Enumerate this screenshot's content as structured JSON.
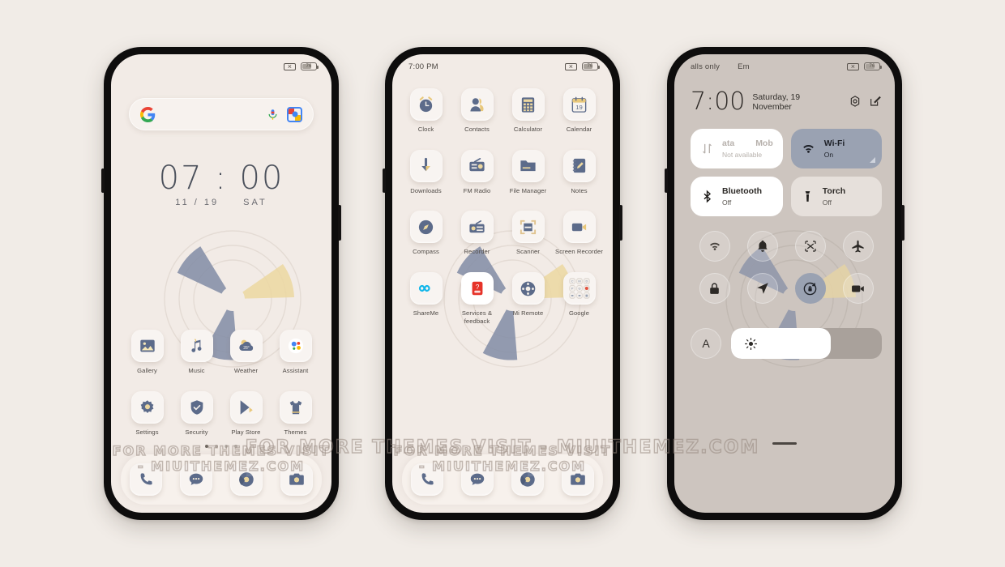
{
  "meta": {
    "watermark": "FOR MORE THEMES VISIT - MIUITHEMEZ.COM",
    "accent_blue": "#5c6b8a",
    "accent_tan": "#e9d39a",
    "page_bg": "#f1ece7",
    "home_bg": "#f2ebe6",
    "cc_bg": "#cdc5bf"
  },
  "phone1": {
    "status": {
      "left": "",
      "battery": "76"
    },
    "search": {
      "placeholder": "",
      "g_icon": "google-g-icon",
      "mic_icon": "microphone-icon",
      "lens_icon": "google-lens-icon"
    },
    "clock": {
      "time": "07 : 00",
      "date": "11 / 19",
      "day": "SAT"
    },
    "apps": [
      {
        "label": "Gallery",
        "icon": "gallery-icon"
      },
      {
        "label": "Music",
        "icon": "music-icon"
      },
      {
        "label": "Weather",
        "icon": "weather-icon",
        "badge": "28°"
      },
      {
        "label": "Assistant",
        "icon": "google-assistant-icon"
      },
      {
        "label": "Settings",
        "icon": "settings-gear-icon"
      },
      {
        "label": "Security",
        "icon": "shield-check-icon"
      },
      {
        "label": "Play Store",
        "icon": "play-store-icon"
      },
      {
        "label": "Themes",
        "icon": "tshirt-icon"
      }
    ],
    "pages": {
      "count": 4,
      "active": 0
    },
    "dock": [
      {
        "label": "Phone",
        "icon": "phone-handset-icon"
      },
      {
        "label": "Messages",
        "icon": "chat-bubble-icon"
      },
      {
        "label": "Chrome",
        "icon": "chrome-icon"
      },
      {
        "label": "Camera",
        "icon": "camera-icon"
      }
    ]
  },
  "phone2": {
    "status": {
      "time": "7:00 PM",
      "battery": "76"
    },
    "apps": [
      {
        "label": "Clock",
        "icon": "alarm-clock-icon"
      },
      {
        "label": "Contacts",
        "icon": "contacts-person-icon"
      },
      {
        "label": "Calculator",
        "icon": "calculator-icon"
      },
      {
        "label": "Calendar",
        "icon": "calendar-icon",
        "day": "19"
      },
      {
        "label": "Downloads",
        "icon": "download-arrow-icon"
      },
      {
        "label": "FM Radio",
        "icon": "radio-icon"
      },
      {
        "label": "File Manager",
        "icon": "folder-icon"
      },
      {
        "label": "Notes",
        "icon": "notepad-pencil-icon"
      },
      {
        "label": "Compass",
        "icon": "compass-icon"
      },
      {
        "label": "Recorder",
        "icon": "voice-recorder-icon"
      },
      {
        "label": "Scanner",
        "icon": "document-scanner-icon"
      },
      {
        "label": "Screen Recorder",
        "icon": "screen-recorder-icon"
      },
      {
        "label": "ShareMe",
        "icon": "shareme-infinity-icon"
      },
      {
        "label": "Services & feedback",
        "icon": "services-feedback-icon"
      },
      {
        "label": "Mi Remote",
        "icon": "mi-remote-icon"
      },
      {
        "label": "Google",
        "icon": "google-folder-icon"
      }
    ],
    "dock": [
      {
        "label": "Phone",
        "icon": "phone-handset-icon"
      },
      {
        "label": "Messages",
        "icon": "chat-bubble-icon"
      },
      {
        "label": "Chrome",
        "icon": "chrome-icon"
      },
      {
        "label": "Camera",
        "icon": "camera-icon"
      }
    ]
  },
  "phone3": {
    "status": {
      "carrier": "alls only",
      "carrier2": "Em",
      "battery": "76"
    },
    "header": {
      "time": "7:00",
      "date": "Saturday, 19 November",
      "settings_icon": "settings-gear-icon",
      "edit_icon": "edit-pencil-icon"
    },
    "big_tiles": [
      {
        "title_a": "ata",
        "title_b": "Mob",
        "sub": "Not available",
        "icon": "mobile-data-arrows-icon",
        "state": "off",
        "style": "white"
      },
      {
        "title": "Wi-Fi",
        "sub": "On",
        "icon": "wifi-icon",
        "state": "on",
        "style": "activeblue"
      },
      {
        "title": "Bluetooth",
        "sub": "Off",
        "icon": "bluetooth-icon",
        "state": "off",
        "style": "white"
      },
      {
        "title": "Torch",
        "sub": "Off",
        "icon": "flashlight-icon",
        "state": "off",
        "style": "pale"
      }
    ],
    "toggles": [
      {
        "name": "wifi",
        "icon": "wifi-icon",
        "on": false
      },
      {
        "name": "silent",
        "icon": "bell-icon",
        "on": false
      },
      {
        "name": "screenshot",
        "icon": "screenshot-scissors-icon",
        "on": false
      },
      {
        "name": "airplane",
        "icon": "airplane-icon",
        "on": false
      },
      {
        "name": "lock",
        "icon": "lock-icon",
        "on": false
      },
      {
        "name": "location",
        "icon": "location-arrow-icon",
        "on": false
      },
      {
        "name": "rotation-lock",
        "icon": "rotation-lock-icon",
        "on": true
      },
      {
        "name": "screen-record",
        "icon": "video-camera-icon",
        "on": false
      }
    ],
    "brightness": {
      "auto_label": "A",
      "icon": "brightness-sun-icon",
      "percent": 66
    }
  }
}
